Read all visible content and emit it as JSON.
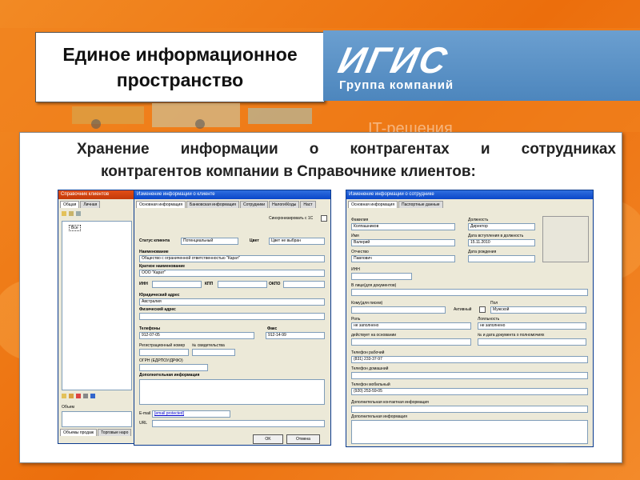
{
  "header": {
    "title_line1": "Единое информационное",
    "title_line2": "пространство",
    "logo_mark": "ИГИС",
    "logo_subtitle": "Группа компаний",
    "background_text": "IT-решения"
  },
  "main_text": {
    "line1": "Хранение информации о контрагентах и сотрудниках",
    "line2": "контрагентов компании в Справочнике клиентов:"
  },
  "left_window": {
    "title": "Справочник клиентов",
    "tabs": [
      "Общая",
      "Личная"
    ],
    "tree_item": "Все",
    "field_label": "Объем",
    "bottom_tabs": [
      "Объемы продаж",
      "Торговые наро"
    ]
  },
  "client_window": {
    "title": "Изменение информации о клиенте",
    "tabs": [
      "Основная информация",
      "Банковская информация",
      "Сотрудники",
      "Налоги\\Коды",
      "Наст"
    ],
    "sync_label": "Синхронизировать с 1С",
    "status_label": "Статус клиента",
    "status_value": "Потенциальный",
    "color_label": "Цвет",
    "color_value": "Цвет не выбран",
    "name_label": "Наименование",
    "name_value": "Общество с ограниченной ответственностью \"Карат\"",
    "short_name_label": "Краткое наименование",
    "short_name_value": "ООО \"Карат\"",
    "inn_label": "ИНН",
    "kpp_label": "КПП",
    "okpo_label": "ОКПО",
    "legal_address_label": "Юридический адрес",
    "legal_address_value": "Австралия",
    "physical_address_label": "Физический адрес",
    "phones_label": "Телефоны",
    "phones_value": "912-07-05",
    "fax_label": "Факс",
    "fax_value": "912-14-99",
    "reg_number_label": "Регистрационный номер",
    "cert_number_label": "№ свидетельства",
    "ogrn_label": "ОГРН (ЕДРПОУ/ДРФО)",
    "extra_info_label": "Дополнительная информация",
    "email_label": "E-mail",
    "email_value": "[email protected]",
    "url_label": "URL",
    "ok_label": "OK",
    "cancel_label": "Отмена"
  },
  "employee_window": {
    "title": "Изменение информации о сотруднике",
    "tabs": [
      "Основная информация",
      "Паспортные данные"
    ],
    "surname_label": "Фамилия",
    "surname_value": "Колпашников",
    "position_label": "Должность",
    "position_value": "Директор",
    "firstname_label": "Имя",
    "firstname_value": "Валерий",
    "hire_date_label": "Дата вступления в должность",
    "hire_date_value": "15.11.2010",
    "patronymic_label": "Отчество",
    "patronymic_value": "Павлович",
    "birth_date_label": "Дата рождения",
    "inn_label": "ИНН",
    "in_person_label": "В лице(для документов)",
    "to_whom_label": "Кому(для писем)",
    "active_label": "Активный",
    "gender_label": "Пол",
    "gender_value": "Мужской",
    "role_label": "Роль",
    "role_value": "не заполнено",
    "loyalty_label": "Лояльность",
    "loyalty_value": "не заполнено",
    "acts_on_label": "действует на основании",
    "power_doc_label": "№ и дата документа о полномочиях",
    "work_phone_label": "Телефон рабочий",
    "work_phone_value": "(831) 233-37-97",
    "home_phone_label": "Телефон домашний",
    "mobile_label": "Телефон мобильный",
    "mobile_value": "(920) 253-59-05",
    "contact_info_label": "Дополнительная контактная информация",
    "extra_info_label": "Дополнительная информация"
  }
}
